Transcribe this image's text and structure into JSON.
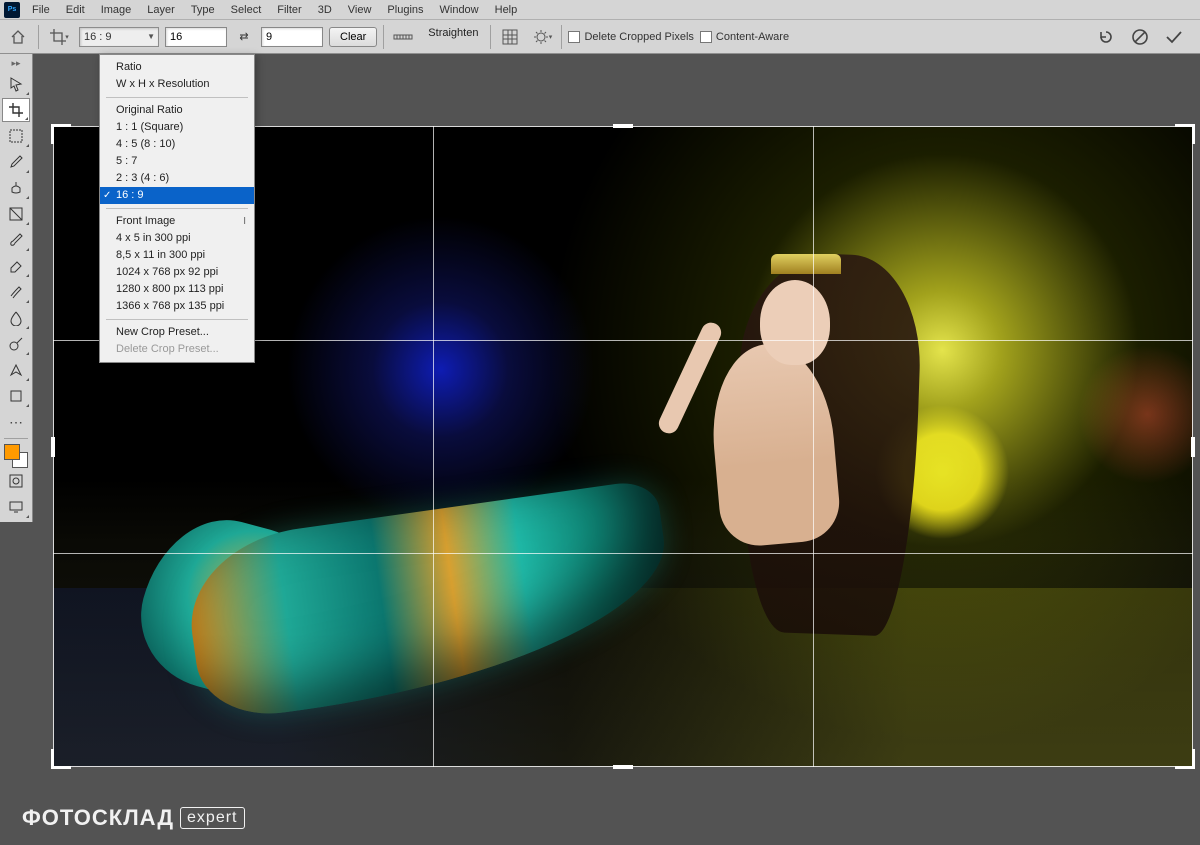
{
  "menubar": {
    "items": [
      "File",
      "Edit",
      "Image",
      "Layer",
      "Type",
      "Select",
      "Filter",
      "3D",
      "View",
      "Plugins",
      "Window",
      "Help"
    ]
  },
  "options": {
    "preset_selected": "16 : 9",
    "width_value": "16",
    "height_value": "9",
    "clear_label": "Clear",
    "straighten_label": "Straighten",
    "delete_cropped_label": "Delete Cropped Pixels",
    "content_aware_label": "Content-Aware"
  },
  "dropdown": {
    "group1": [
      "Ratio",
      "W x H x Resolution"
    ],
    "group2_header": "Original Ratio",
    "group2": [
      "1 : 1 (Square)",
      "4 : 5 (8 : 10)",
      "5 : 7",
      "2 : 3 (4 : 6)",
      "16 : 9"
    ],
    "selected": "16 : 9",
    "group3_header": "Front Image",
    "group3_shortcut": "I",
    "group3": [
      "4 x 5 in 300 ppi",
      "8,5 x 11 in 300 ppi",
      "1024 x 768 px 92 ppi",
      "1280 x 800 px 113 ppi",
      "1366 x 768 px 135 ppi"
    ],
    "new_preset": "New Crop Preset...",
    "delete_preset": "Delete Crop Preset..."
  },
  "tools": {
    "list": [
      "move",
      "crop",
      "frame",
      "marquee",
      "eyedropper",
      "clone-stamp",
      "gradient",
      "brush",
      "eraser",
      "history-brush",
      "blur",
      "dodge",
      "pen",
      "shape"
    ],
    "active": "crop"
  },
  "swatch": {
    "foreground": "#ff9a00",
    "background": "#ffffff"
  },
  "watermark": {
    "brand": "ФОТОСКЛАД",
    "tag": "expert"
  }
}
